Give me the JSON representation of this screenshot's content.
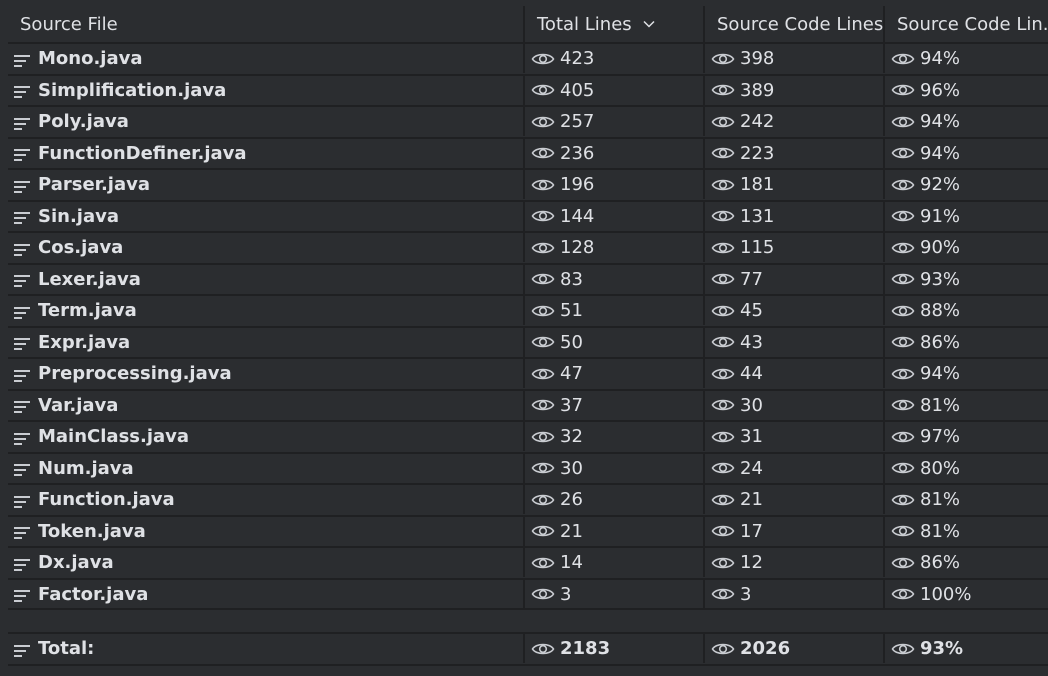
{
  "columns": [
    "Source File",
    "Total Lines",
    "Source Code Lines",
    "Source Code Lin..."
  ],
  "rows": [
    {
      "file": "Mono.java",
      "total": "423",
      "code": "398",
      "pct": "94%"
    },
    {
      "file": "Simplification.java",
      "total": "405",
      "code": "389",
      "pct": "96%"
    },
    {
      "file": "Poly.java",
      "total": "257",
      "code": "242",
      "pct": "94%"
    },
    {
      "file": "FunctionDefiner.java",
      "total": "236",
      "code": "223",
      "pct": "94%"
    },
    {
      "file": "Parser.java",
      "total": "196",
      "code": "181",
      "pct": "92%"
    },
    {
      "file": "Sin.java",
      "total": "144",
      "code": "131",
      "pct": "91%"
    },
    {
      "file": "Cos.java",
      "total": "128",
      "code": "115",
      "pct": "90%"
    },
    {
      "file": "Lexer.java",
      "total": "83",
      "code": "77",
      "pct": "93%"
    },
    {
      "file": "Term.java",
      "total": "51",
      "code": "45",
      "pct": "88%"
    },
    {
      "file": "Expr.java",
      "total": "50",
      "code": "43",
      "pct": "86%"
    },
    {
      "file": "Preprocessing.java",
      "total": "47",
      "code": "44",
      "pct": "94%"
    },
    {
      "file": "Var.java",
      "total": "37",
      "code": "30",
      "pct": "81%"
    },
    {
      "file": "MainClass.java",
      "total": "32",
      "code": "31",
      "pct": "97%"
    },
    {
      "file": "Num.java",
      "total": "30",
      "code": "24",
      "pct": "80%"
    },
    {
      "file": "Function.java",
      "total": "26",
      "code": "21",
      "pct": "81%"
    },
    {
      "file": "Token.java",
      "total": "21",
      "code": "17",
      "pct": "81%"
    },
    {
      "file": "Dx.java",
      "total": "14",
      "code": "12",
      "pct": "86%"
    },
    {
      "file": "Factor.java",
      "total": "3",
      "code": "3",
      "pct": "100%"
    }
  ],
  "total": {
    "label": "Total:",
    "total": "2183",
    "code": "2026",
    "pct": "93%"
  },
  "icons": {
    "row": "lines-icon",
    "value": "eye-icon",
    "sort": "chevron-down-icon"
  },
  "colors": {
    "background": "#2b2d30",
    "grid": "#1f2022",
    "text": "#dfe1e5"
  }
}
